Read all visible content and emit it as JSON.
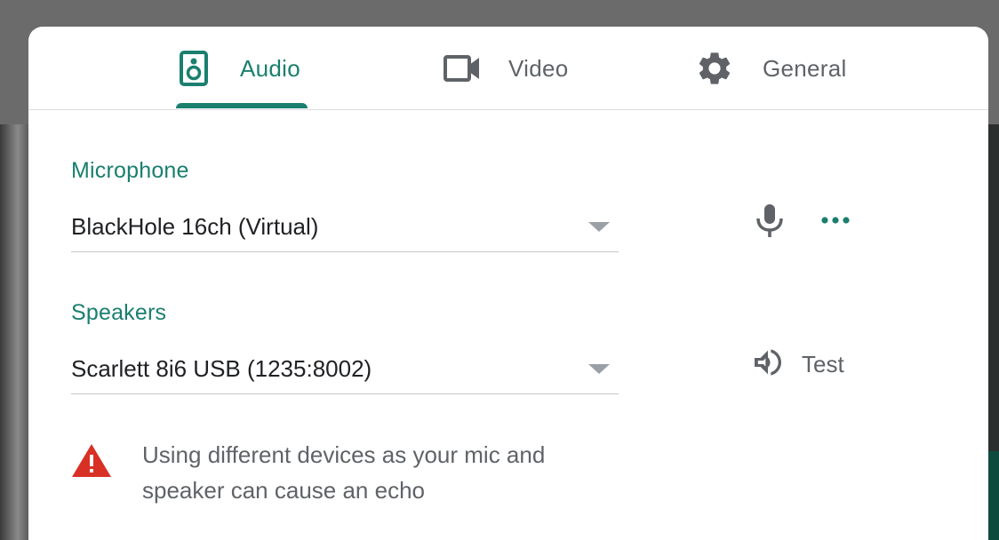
{
  "tabs": [
    {
      "label": "Audio",
      "icon": "speaker-icon",
      "active": true
    },
    {
      "label": "Video",
      "icon": "videocam-icon",
      "active": false
    },
    {
      "label": "General",
      "icon": "gear-icon",
      "active": false
    }
  ],
  "microphone": {
    "label": "Microphone",
    "selected": "BlackHole 16ch (Virtual)",
    "icons": [
      "mic-icon",
      "more-horiz-icon"
    ]
  },
  "speakers": {
    "label": "Speakers",
    "selected": "Scarlett 8i6 USB (1235:8002)",
    "test_label": "Test",
    "icon": "volume-icon"
  },
  "warning": {
    "text": "Using different devices as your mic and speaker can cause an echo",
    "icon": "warning-icon"
  },
  "colors": {
    "accent": "#1a7f6e",
    "text": "#202124",
    "secondary": "#5f6368",
    "warning": "#d93025"
  }
}
